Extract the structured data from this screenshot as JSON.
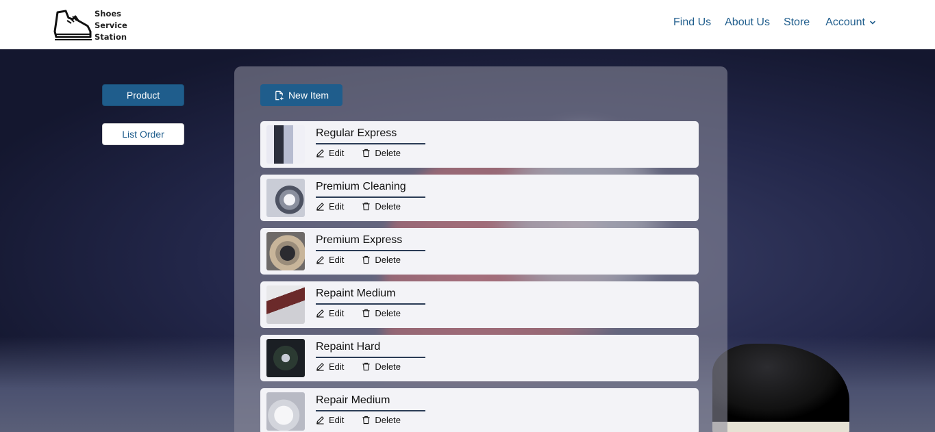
{
  "header": {
    "logo_lines": [
      "Shoes",
      "Service",
      "Station"
    ],
    "nav": {
      "find_us": "Find Us",
      "about_us": "About Us",
      "store": "Store",
      "account": "Account"
    }
  },
  "sidebar": {
    "product_label": "Product",
    "list_order_label": "List Order"
  },
  "panel": {
    "new_item_label": "New Item",
    "items": [
      {
        "title": "Regular Express",
        "edit": "Edit",
        "delete": "Delete",
        "thumb_icon": "ironing-clothes-photo"
      },
      {
        "title": "Premium Cleaning",
        "edit": "Edit",
        "delete": "Delete",
        "thumb_icon": "washing-machine-photo"
      },
      {
        "title": "Premium Express",
        "edit": "Edit",
        "delete": "Delete",
        "thumb_icon": "washing-machine-photo"
      },
      {
        "title": "Repaint Medium",
        "edit": "Edit",
        "delete": "Delete",
        "thumb_icon": "shoe-repaint-photo"
      },
      {
        "title": "Repaint Hard",
        "edit": "Edit",
        "delete": "Delete",
        "thumb_icon": "shoe-cleaning-photo"
      },
      {
        "title": "Repair Medium",
        "edit": "Edit",
        "delete": "Delete",
        "thumb_icon": "cleaning-supplies-photo"
      }
    ]
  },
  "colors": {
    "brand": "#1f5d8c",
    "item_bg": "#f3f3f7"
  }
}
